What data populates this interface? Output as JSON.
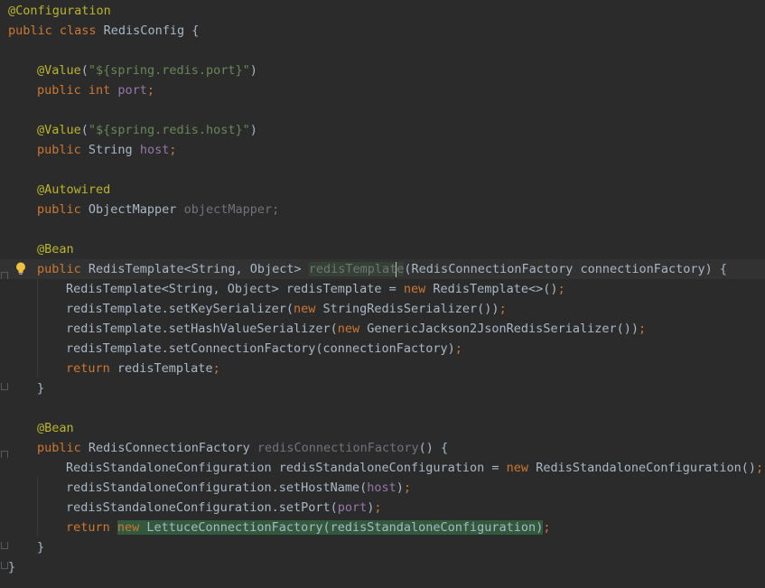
{
  "editor": {
    "lines": [
      {
        "indent": 0,
        "tokens": [
          [
            "ann",
            "@Configuration"
          ]
        ]
      },
      {
        "indent": 0,
        "tokens": [
          [
            "kw",
            "public class "
          ],
          [
            "cls",
            "RedisConfig {"
          ]
        ]
      },
      {
        "indent": 0,
        "tokens": []
      },
      {
        "indent": 1,
        "tokens": [
          [
            "ann",
            "@Value"
          ],
          [
            "cls",
            "("
          ],
          [
            "str",
            "\"${spring.redis.port}\""
          ],
          [
            "cls",
            ")"
          ]
        ]
      },
      {
        "indent": 1,
        "tokens": [
          [
            "kw",
            "public int "
          ],
          [
            "fld",
            "port"
          ],
          [
            "kw",
            ";"
          ]
        ]
      },
      {
        "indent": 0,
        "tokens": []
      },
      {
        "indent": 1,
        "tokens": [
          [
            "ann",
            "@Value"
          ],
          [
            "cls",
            "("
          ],
          [
            "str",
            "\"${spring.redis.host}\""
          ],
          [
            "cls",
            ")"
          ]
        ]
      },
      {
        "indent": 1,
        "tokens": [
          [
            "kw",
            "public "
          ],
          [
            "cls",
            "String "
          ],
          [
            "fld",
            "host"
          ],
          [
            "kw",
            ";"
          ]
        ]
      },
      {
        "indent": 0,
        "tokens": []
      },
      {
        "indent": 1,
        "tokens": [
          [
            "ann",
            "@Autowired"
          ]
        ]
      },
      {
        "indent": 1,
        "tokens": [
          [
            "kw",
            "public "
          ],
          [
            "cls",
            "ObjectMapper "
          ],
          [
            "dim",
            "objectMapper;"
          ]
        ]
      },
      {
        "indent": 0,
        "tokens": []
      },
      {
        "indent": 1,
        "tokens": [
          [
            "ann",
            "@Bean"
          ]
        ]
      },
      {
        "indent": 1,
        "current": true,
        "tokens": [
          [
            "kw",
            "public "
          ],
          [
            "cls",
            "RedisTemplate<String, Object> "
          ],
          [
            "dim usedecl",
            "redisTemplate"
          ],
          [
            "cls",
            "(RedisConnectionFactory connectionFactory) {"
          ]
        ]
      },
      {
        "indent": 2,
        "tokens": [
          [
            "cls",
            "RedisTemplate<String, Object> redisTemplate = "
          ],
          [
            "kw",
            "new "
          ],
          [
            "cls",
            "RedisTemplate<>()"
          ],
          [
            "kw",
            ";"
          ]
        ]
      },
      {
        "indent": 2,
        "tokens": [
          [
            "cls",
            "redisTemplate.setKeySerializer("
          ],
          [
            "kw",
            "new "
          ],
          [
            "cls",
            "StringRedisSerializer())"
          ],
          [
            "kw",
            ";"
          ]
        ]
      },
      {
        "indent": 2,
        "tokens": [
          [
            "cls",
            "redisTemplate.setHashValueSerializer("
          ],
          [
            "kw",
            "new "
          ],
          [
            "cls",
            "GenericJackson2JsonRedisSerializer())"
          ],
          [
            "kw",
            ";"
          ]
        ]
      },
      {
        "indent": 2,
        "tokens": [
          [
            "cls",
            "redisTemplate.setConnectionFactory(connectionFactory)"
          ],
          [
            "kw",
            ";"
          ]
        ]
      },
      {
        "indent": 2,
        "tokens": [
          [
            "kw",
            "return "
          ],
          [
            "cls",
            "redisTemplate"
          ],
          [
            "kw",
            ";"
          ]
        ]
      },
      {
        "indent": 1,
        "tokens": [
          [
            "cls",
            "}"
          ]
        ]
      },
      {
        "indent": 0,
        "tokens": []
      },
      {
        "indent": 1,
        "tokens": [
          [
            "ann",
            "@Bean"
          ]
        ]
      },
      {
        "indent": 1,
        "tokens": [
          [
            "kw",
            "public "
          ],
          [
            "cls",
            "RedisConnectionFactory "
          ],
          [
            "dim",
            "redisConnectionFactory"
          ],
          [
            "cls",
            "() {"
          ]
        ]
      },
      {
        "indent": 2,
        "tokens": [
          [
            "cls",
            "RedisStandaloneConfiguration redisStandaloneConfiguration = "
          ],
          [
            "kw",
            "new "
          ],
          [
            "cls",
            "RedisStandaloneConfiguration()"
          ],
          [
            "kw",
            ";"
          ]
        ]
      },
      {
        "indent": 2,
        "tokens": [
          [
            "cls",
            "redisStandaloneConfiguration.setHostName("
          ],
          [
            "fld",
            "host"
          ],
          [
            "cls",
            ")"
          ],
          [
            "kw",
            ";"
          ]
        ]
      },
      {
        "indent": 2,
        "tokens": [
          [
            "cls",
            "redisStandaloneConfiguration.setPort("
          ],
          [
            "fld",
            "port"
          ],
          [
            "cls",
            ")"
          ],
          [
            "kw",
            ";"
          ]
        ]
      },
      {
        "indent": 2,
        "tokens": [
          [
            "kw",
            "return "
          ],
          [
            "kw hl-ret",
            "new "
          ],
          [
            "cls hl-ret",
            "LettuceConnectionFactory(redisStandaloneConfiguration)"
          ],
          [
            "kw",
            ";"
          ]
        ]
      },
      {
        "indent": 1,
        "tokens": [
          [
            "cls",
            "}"
          ]
        ]
      },
      {
        "indent": 0,
        "tokens": [
          [
            "cls",
            "}"
          ]
        ]
      }
    ]
  }
}
